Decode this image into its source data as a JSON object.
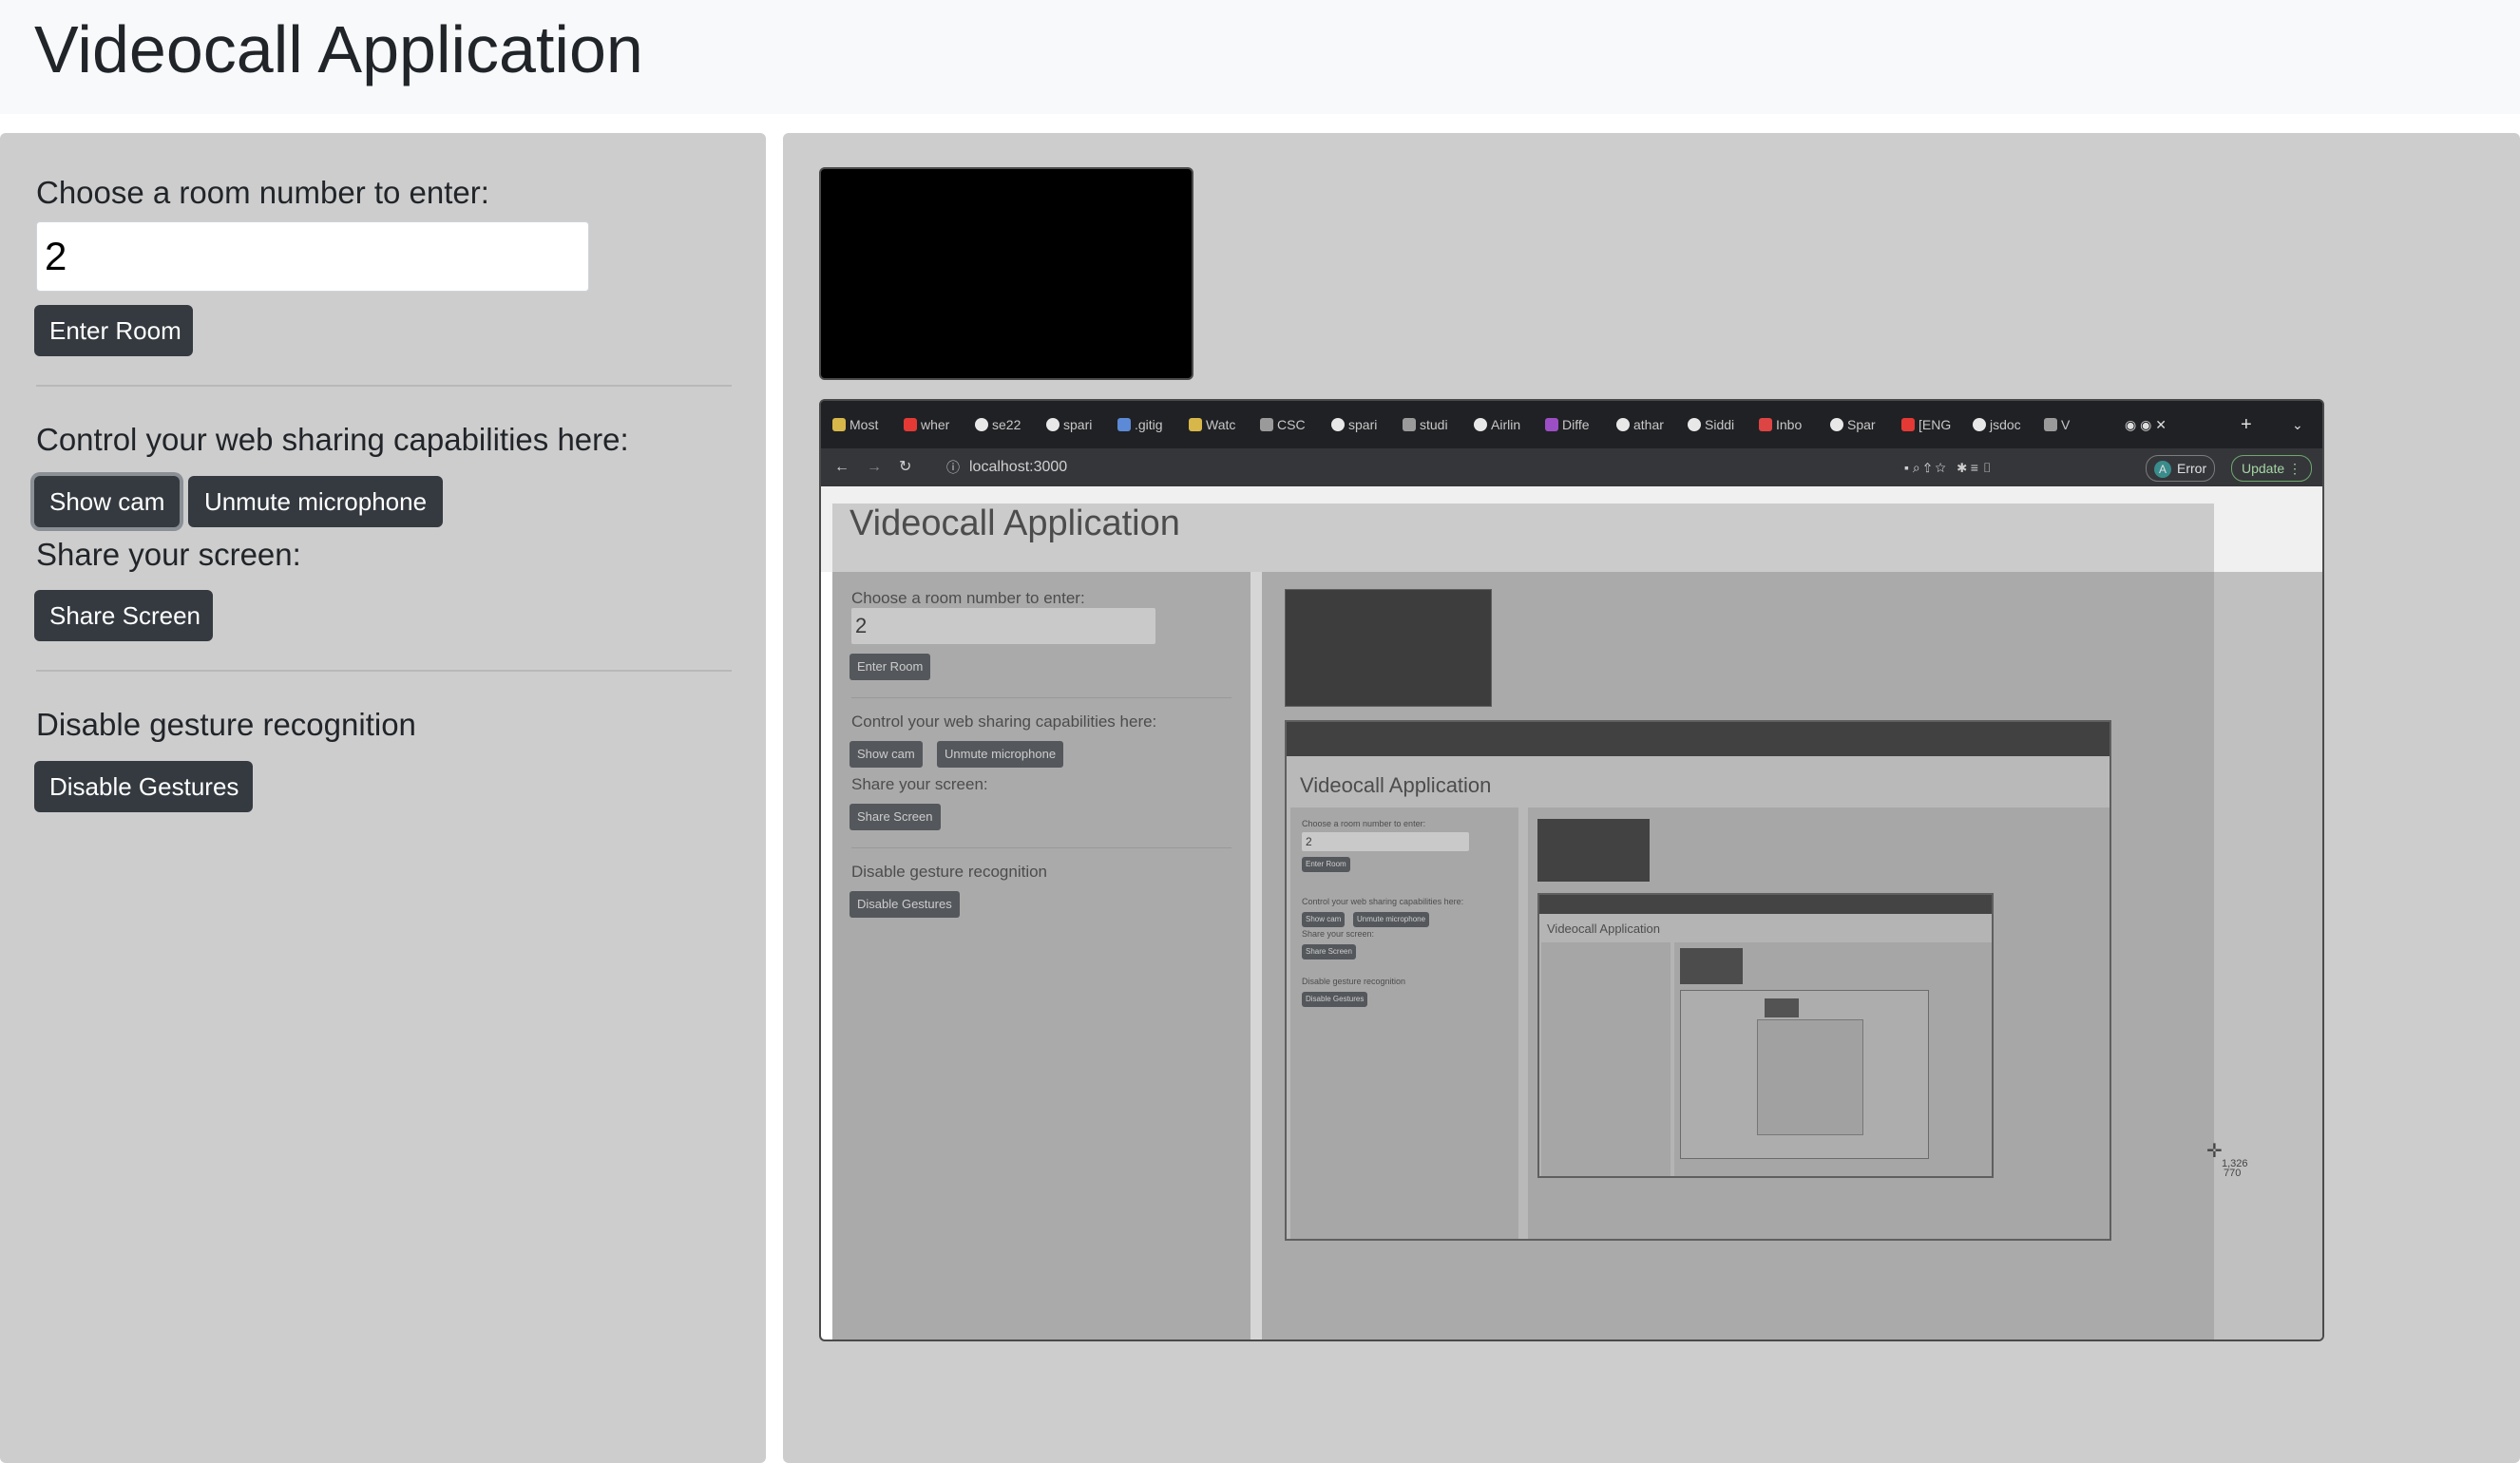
{
  "header": {
    "title": "Videocall Application"
  },
  "sidebar": {
    "room_label": "Choose a room number to enter:",
    "room_value": "2",
    "enter_room": "Enter Room",
    "control_label": "Control your web sharing capabilities here:",
    "show_cam": "Show cam",
    "unmute_mic": "Unmute microphone",
    "share_label": "Share your screen:",
    "share_screen": "Share Screen",
    "gesture_label": "Disable gesture recognition",
    "disable_gestures": "Disable Gestures"
  },
  "shared_screen": {
    "tabs": [
      {
        "label": "Most",
        "icon": "bookmark-icon"
      },
      {
        "label": "wher",
        "icon": "youtube-icon"
      },
      {
        "label": "se22",
        "icon": "github-icon"
      },
      {
        "label": "spari",
        "icon": "github-icon"
      },
      {
        "label": ".gitig",
        "icon": "file-icon"
      },
      {
        "label": "Watc",
        "icon": "bookmark-icon"
      },
      {
        "label": "CSC",
        "icon": "globe-icon"
      },
      {
        "label": "spari",
        "icon": "github-icon"
      },
      {
        "label": "studi",
        "icon": "globe-icon"
      },
      {
        "label": "Airlin",
        "icon": "github-icon"
      },
      {
        "label": "Diffe",
        "icon": "app-icon"
      },
      {
        "label": "athar",
        "icon": "github-icon"
      },
      {
        "label": "Siddi",
        "icon": "github-icon"
      },
      {
        "label": "Inbo",
        "icon": "mail-icon"
      },
      {
        "label": "Spar",
        "icon": "github-icon"
      },
      {
        "label": "[ENG",
        "icon": "youtube-icon"
      },
      {
        "label": "jsdoc",
        "icon": "github-icon"
      },
      {
        "label": "V",
        "icon": "globe-icon"
      }
    ],
    "url": "localhost:3000",
    "profile_initial": "A",
    "error_label": "Error",
    "update_label": "Update",
    "page": {
      "title": "Videocall Application",
      "room_label": "Choose a room number to enter:",
      "room_value": "2",
      "enter_room": "Enter Room",
      "control_label": "Control your web sharing capabilities here:",
      "show_cam": "Show cam",
      "unmute_mic": "Unmute microphone",
      "share_label": "Share your screen:",
      "share_screen": "Share Screen",
      "gesture_label": "Disable gesture recognition",
      "disable_gestures": "Disable Gestures"
    },
    "nested": {
      "title": "Videocall Application",
      "room_label": "Choose a room number to enter:",
      "room_value": "2",
      "enter_room": "Enter Room",
      "control_label": "Control your web sharing capabilities here:",
      "show_cam": "Show cam",
      "unmute_mic": "Unmute microphone",
      "share_label": "Share your screen:",
      "share_screen": "Share Screen",
      "gesture_label": "Disable gesture recognition",
      "disable_gestures": "Disable Gestures",
      "inner_title": "Videocall Application"
    },
    "cursor_readout": [
      "1,326",
      "770"
    ]
  }
}
